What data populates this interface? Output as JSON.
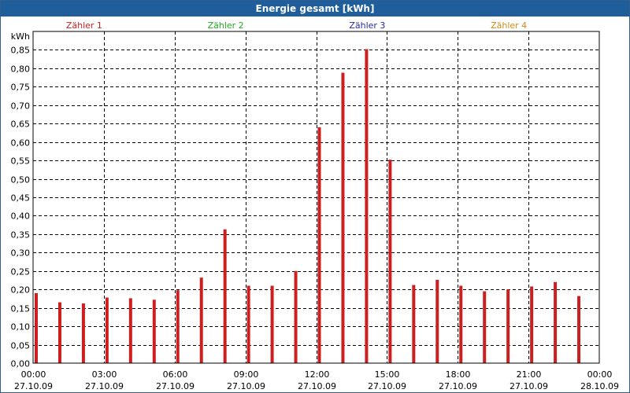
{
  "window": {
    "title": "Energie gesamt [kWh]"
  },
  "chart_data": {
    "type": "bar",
    "title": "Energie gesamt [kWh]",
    "ylabel": "kWh",
    "ylim": [
      0,
      0.9
    ],
    "y_ticks": [
      "0,00",
      "0,05",
      "0,10",
      "0,15",
      "0,20",
      "0,25",
      "0,30",
      "0,35",
      "0,40",
      "0,45",
      "0,50",
      "0,55",
      "0,60",
      "0,65",
      "0,70",
      "0,75",
      "0,80",
      "0,85"
    ],
    "x_tick_times": [
      "00:00",
      "03:00",
      "06:00",
      "09:00",
      "12:00",
      "15:00",
      "18:00",
      "21:00",
      "00:00"
    ],
    "x_tick_dates": [
      "27.10.09",
      "27.10.09",
      "27.10.09",
      "27.10.09",
      "27.10.09",
      "27.10.09",
      "27.10.09",
      "27.10.09",
      "28.10.09"
    ],
    "legend": [
      {
        "name": "Zähler 1",
        "color": "#cc1f1f"
      },
      {
        "name": "Zähler 2",
        "color": "#22aa22"
      },
      {
        "name": "Zähler 3",
        "color": "#2a2aa0"
      },
      {
        "name": "Zähler 4",
        "color": "#d08a1c"
      }
    ],
    "grid": true,
    "series": [
      {
        "name": "Zähler 1",
        "color": "#cc1f1f",
        "x": [
          "00:00",
          "01:00",
          "02:00",
          "03:00",
          "04:00",
          "05:00",
          "06:00",
          "07:00",
          "08:00",
          "09:00",
          "10:00",
          "11:00",
          "12:00",
          "13:00",
          "14:00",
          "15:00",
          "16:00",
          "17:00",
          "18:00",
          "19:00",
          "20:00",
          "21:00",
          "22:00",
          "23:00"
        ],
        "values": [
          0.19,
          0.165,
          0.162,
          0.178,
          0.176,
          0.172,
          0.198,
          0.232,
          0.363,
          0.21,
          0.21,
          0.25,
          0.64,
          0.788,
          0.852,
          0.552,
          0.212,
          0.226,
          0.21,
          0.195,
          0.2,
          0.208,
          0.22,
          0.182
        ]
      }
    ]
  }
}
